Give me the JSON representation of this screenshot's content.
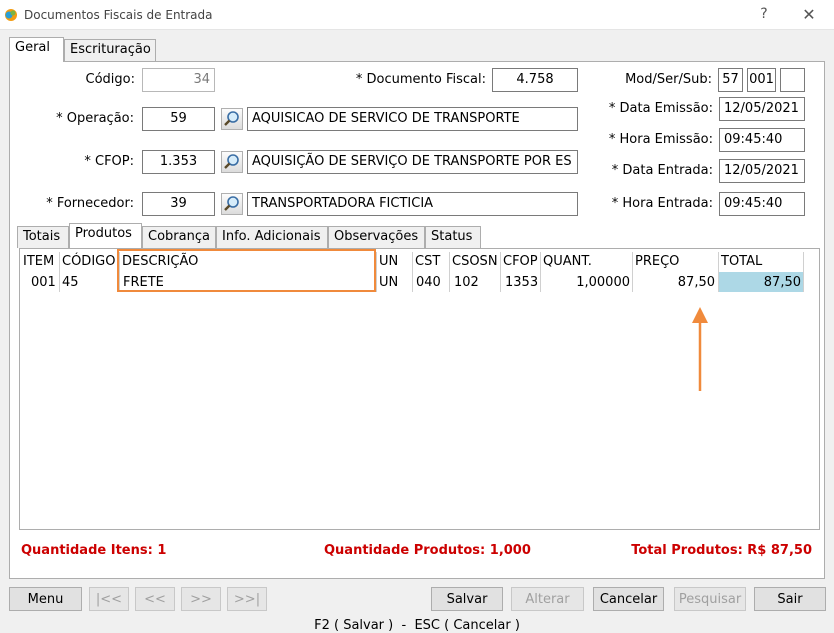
{
  "window": {
    "title": "Documentos Fiscais de Entrada",
    "help": "?",
    "close": "✕"
  },
  "top_tabs": [
    "Geral",
    "Escrituração"
  ],
  "fields": {
    "codigo": {
      "label": "Código:",
      "value": "34"
    },
    "documento_fiscal": {
      "label": "* Documento Fiscal:",
      "value": "4.758"
    },
    "mod_ser_sub": {
      "label": "Mod/Ser/Sub:",
      "mod": "57",
      "ser": "001",
      "sub": ""
    },
    "operacao": {
      "label": "* Operação:",
      "code": "59",
      "desc": "AQUISICAO DE SERVICO DE TRANSPORTE"
    },
    "cfop": {
      "label": "* CFOP:",
      "code": "1.353",
      "desc": "AQUISIÇÃO DE SERVIÇO DE TRANSPORTE POR ES"
    },
    "fornecedor": {
      "label": "* Fornecedor:",
      "code": "39",
      "desc": "TRANSPORTADORA FICTICIA"
    },
    "data_emissao": {
      "label": "* Data Emissão:",
      "value": "12/05/2021"
    },
    "hora_emissao": {
      "label": "* Hora Emissão:",
      "value": "09:45:40"
    },
    "data_entrada": {
      "label": "* Data Entrada:",
      "value": "12/05/2021"
    },
    "hora_entrada": {
      "label": "* Hora Entrada:",
      "value": "09:45:40"
    }
  },
  "sub_tabs": [
    "Totais",
    "Produtos",
    "Cobrança",
    "Info. Adicionais",
    "Observações",
    "Status"
  ],
  "grid": {
    "columns": [
      "ITEM",
      "CÓDIGO",
      "DESCRIÇÃO",
      "UN",
      "CST",
      "CSOSN",
      "CFOP",
      "QUANT.",
      "PREÇO",
      "TOTAL"
    ],
    "rows": [
      [
        "001",
        "45",
        "FRETE",
        "UN",
        "040",
        "102",
        "1353",
        "1,00000",
        "87,50",
        "87,50"
      ]
    ]
  },
  "summary": {
    "qtd_itens": "Quantidade Itens: 1",
    "qtd_produtos": "Quantidade Produtos: 1,000",
    "total_produtos": "Total Produtos: R$ 87,50"
  },
  "buttons": {
    "menu": "Menu",
    "first": "|<<",
    "prev": "<<",
    "next": ">>",
    "last": ">>|",
    "salvar": "Salvar",
    "alterar": "Alterar",
    "cancelar": "Cancelar",
    "pesquisar": "Pesquisar",
    "sair": "Sair"
  },
  "status_bar": "F2 ( Salvar )  -  ESC ( Cancelar )",
  "colors": {
    "highlight_box": "#f08a3c",
    "selected_cell": "#add8e6",
    "summary_text": "#cc0000"
  }
}
